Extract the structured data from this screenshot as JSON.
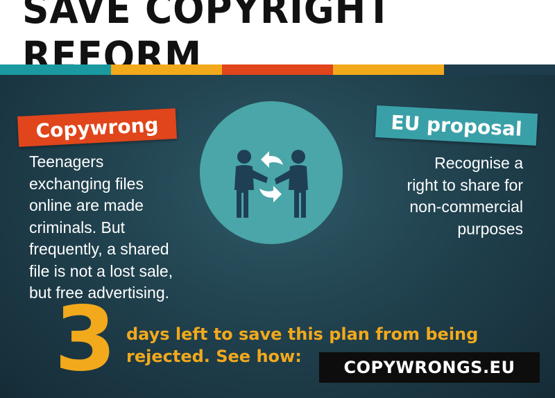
{
  "header": {
    "title": "SAVE COPYRIGHT REFORM"
  },
  "stripe_colors": [
    "#1a9aa0",
    "#f2a91c",
    "#e0451b",
    "#f2a91c",
    "#1d3d4c"
  ],
  "left_panel": {
    "label": "Copywrong",
    "label_color": "#e0451b",
    "lines": [
      "Teenagers",
      "exchanging files",
      "online are made",
      "criminals. But",
      "frequently, a shared",
      "file is not a lost sale,",
      "but free advertising."
    ]
  },
  "right_panel": {
    "label": "EU proposal",
    "label_color": "#3aa0a8",
    "lines": [
      "Recognise a",
      "right to share for",
      "non-commercial",
      "purposes"
    ]
  },
  "illustration": {
    "icon": "people-exchanging-icon",
    "circle_color": "#4aa6a8",
    "figure_color": "#1f3f55"
  },
  "cta": {
    "number": "3",
    "line1": "days left to save this plan from being",
    "line2": "rejected. See how:",
    "accent_color": "#f2a91c",
    "url": "COPYWRONGS.EU"
  }
}
